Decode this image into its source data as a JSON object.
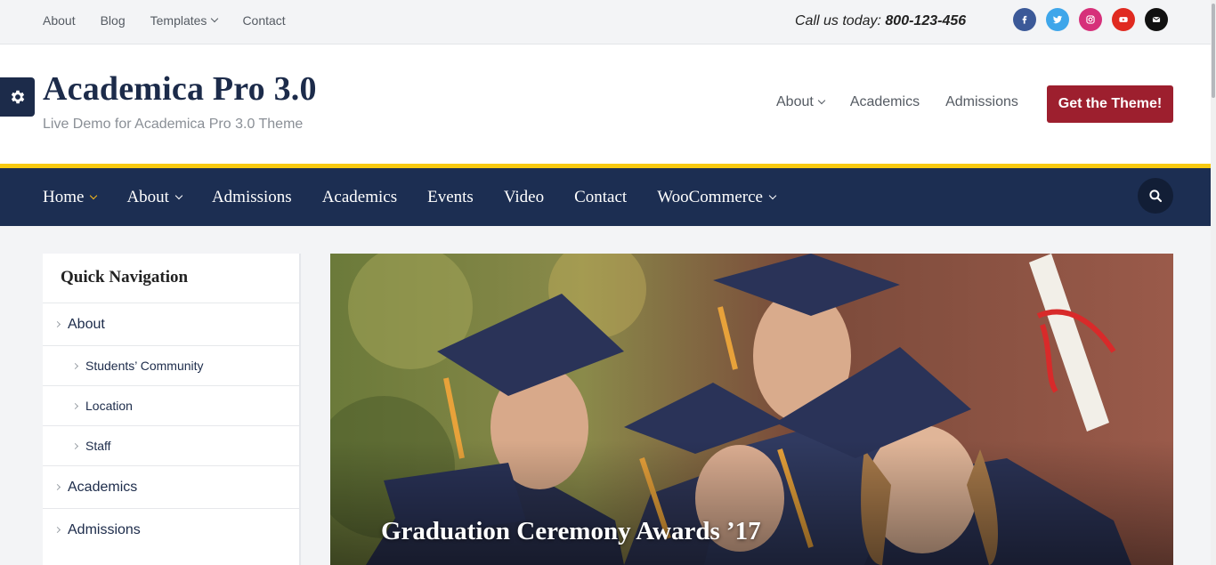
{
  "topbar": {
    "links": [
      "About",
      "Blog",
      "Templates",
      "Contact"
    ],
    "call_prefix": "Call us today:",
    "call_number": "800-123-456",
    "socials": [
      {
        "name": "facebook-icon",
        "color": "#3b5998"
      },
      {
        "name": "twitter-icon",
        "color": "#3ea6ea"
      },
      {
        "name": "instagram-icon",
        "color": "#d6307a"
      },
      {
        "name": "youtube-icon",
        "color": "#e02a20"
      },
      {
        "name": "email-icon",
        "color": "#111111"
      }
    ]
  },
  "header": {
    "title": "Academica Pro 3.0",
    "tagline": "Live Demo for Academica Pro 3.0 Theme",
    "nav": [
      "About",
      "Academics",
      "Admissions"
    ],
    "cta": "Get the Theme!"
  },
  "mainnav": {
    "items": [
      "Home",
      "About",
      "Admissions",
      "Academics",
      "Events",
      "Video",
      "Contact",
      "WooCommerce"
    ],
    "active": "Home"
  },
  "sidebar": {
    "title": "Quick Navigation",
    "items": [
      {
        "label": "About",
        "level": 0
      },
      {
        "label": "Students’ Community",
        "level": 1
      },
      {
        "label": "Location",
        "level": 1
      },
      {
        "label": "Staff",
        "level": 1
      },
      {
        "label": "Academics",
        "level": 0
      },
      {
        "label": "Admissions",
        "level": 0
      }
    ]
  },
  "hero": {
    "caption": "Graduation Ceremony Awards ’17"
  },
  "colors": {
    "navy": "#1c2e52",
    "accent_yellow": "#f7c910",
    "cta_red": "#9d1f2e"
  }
}
